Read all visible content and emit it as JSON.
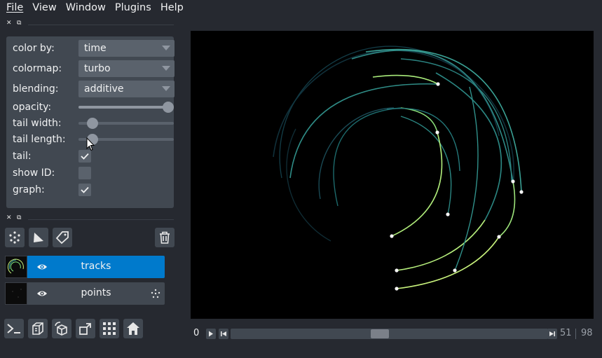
{
  "menubar": {
    "items": [
      {
        "label": "File"
      },
      {
        "label": "View"
      },
      {
        "label": "Window"
      },
      {
        "label": "Plugins"
      },
      {
        "label": "Help"
      }
    ]
  },
  "layer_controls": {
    "color_by": {
      "label": "color by:",
      "value": "time"
    },
    "colormap": {
      "label": "colormap:",
      "value": "turbo"
    },
    "blending": {
      "label": "blending:",
      "value": "additive"
    },
    "opacity": {
      "label": "opacity:",
      "value": 1.0
    },
    "tail_width": {
      "label": "tail width:",
      "value": 0.15
    },
    "tail_length": {
      "label": "tail length:",
      "value": 0.15
    },
    "tail": {
      "label": "tail:",
      "checked": true
    },
    "show_id": {
      "label": "show ID:",
      "checked": false
    },
    "graph": {
      "label": "graph:",
      "checked": true
    }
  },
  "layer_buttons": {
    "new_points": "new-points-icon",
    "new_shapes": "new-shapes-icon",
    "new_labels": "new-labels-icon",
    "delete": "delete-icon"
  },
  "layers": [
    {
      "name": "tracks",
      "visible": true,
      "selected": true,
      "type_icon": "tracks-icon"
    },
    {
      "name": "points",
      "visible": true,
      "selected": false,
      "type_icon": "points-icon"
    }
  ],
  "bottom_tools": [
    "console-icon",
    "ndisplay-icon",
    "roll-icon",
    "transpose-icon",
    "grid-icon",
    "home-icon"
  ],
  "dims": {
    "slider_index": "0",
    "current": "51",
    "total": "98",
    "position_fraction": 0.52
  },
  "colors": {
    "window_bg": "#262930",
    "panel_bg": "#414851",
    "selection": "#007acc",
    "canvas_bg": "#000000"
  }
}
